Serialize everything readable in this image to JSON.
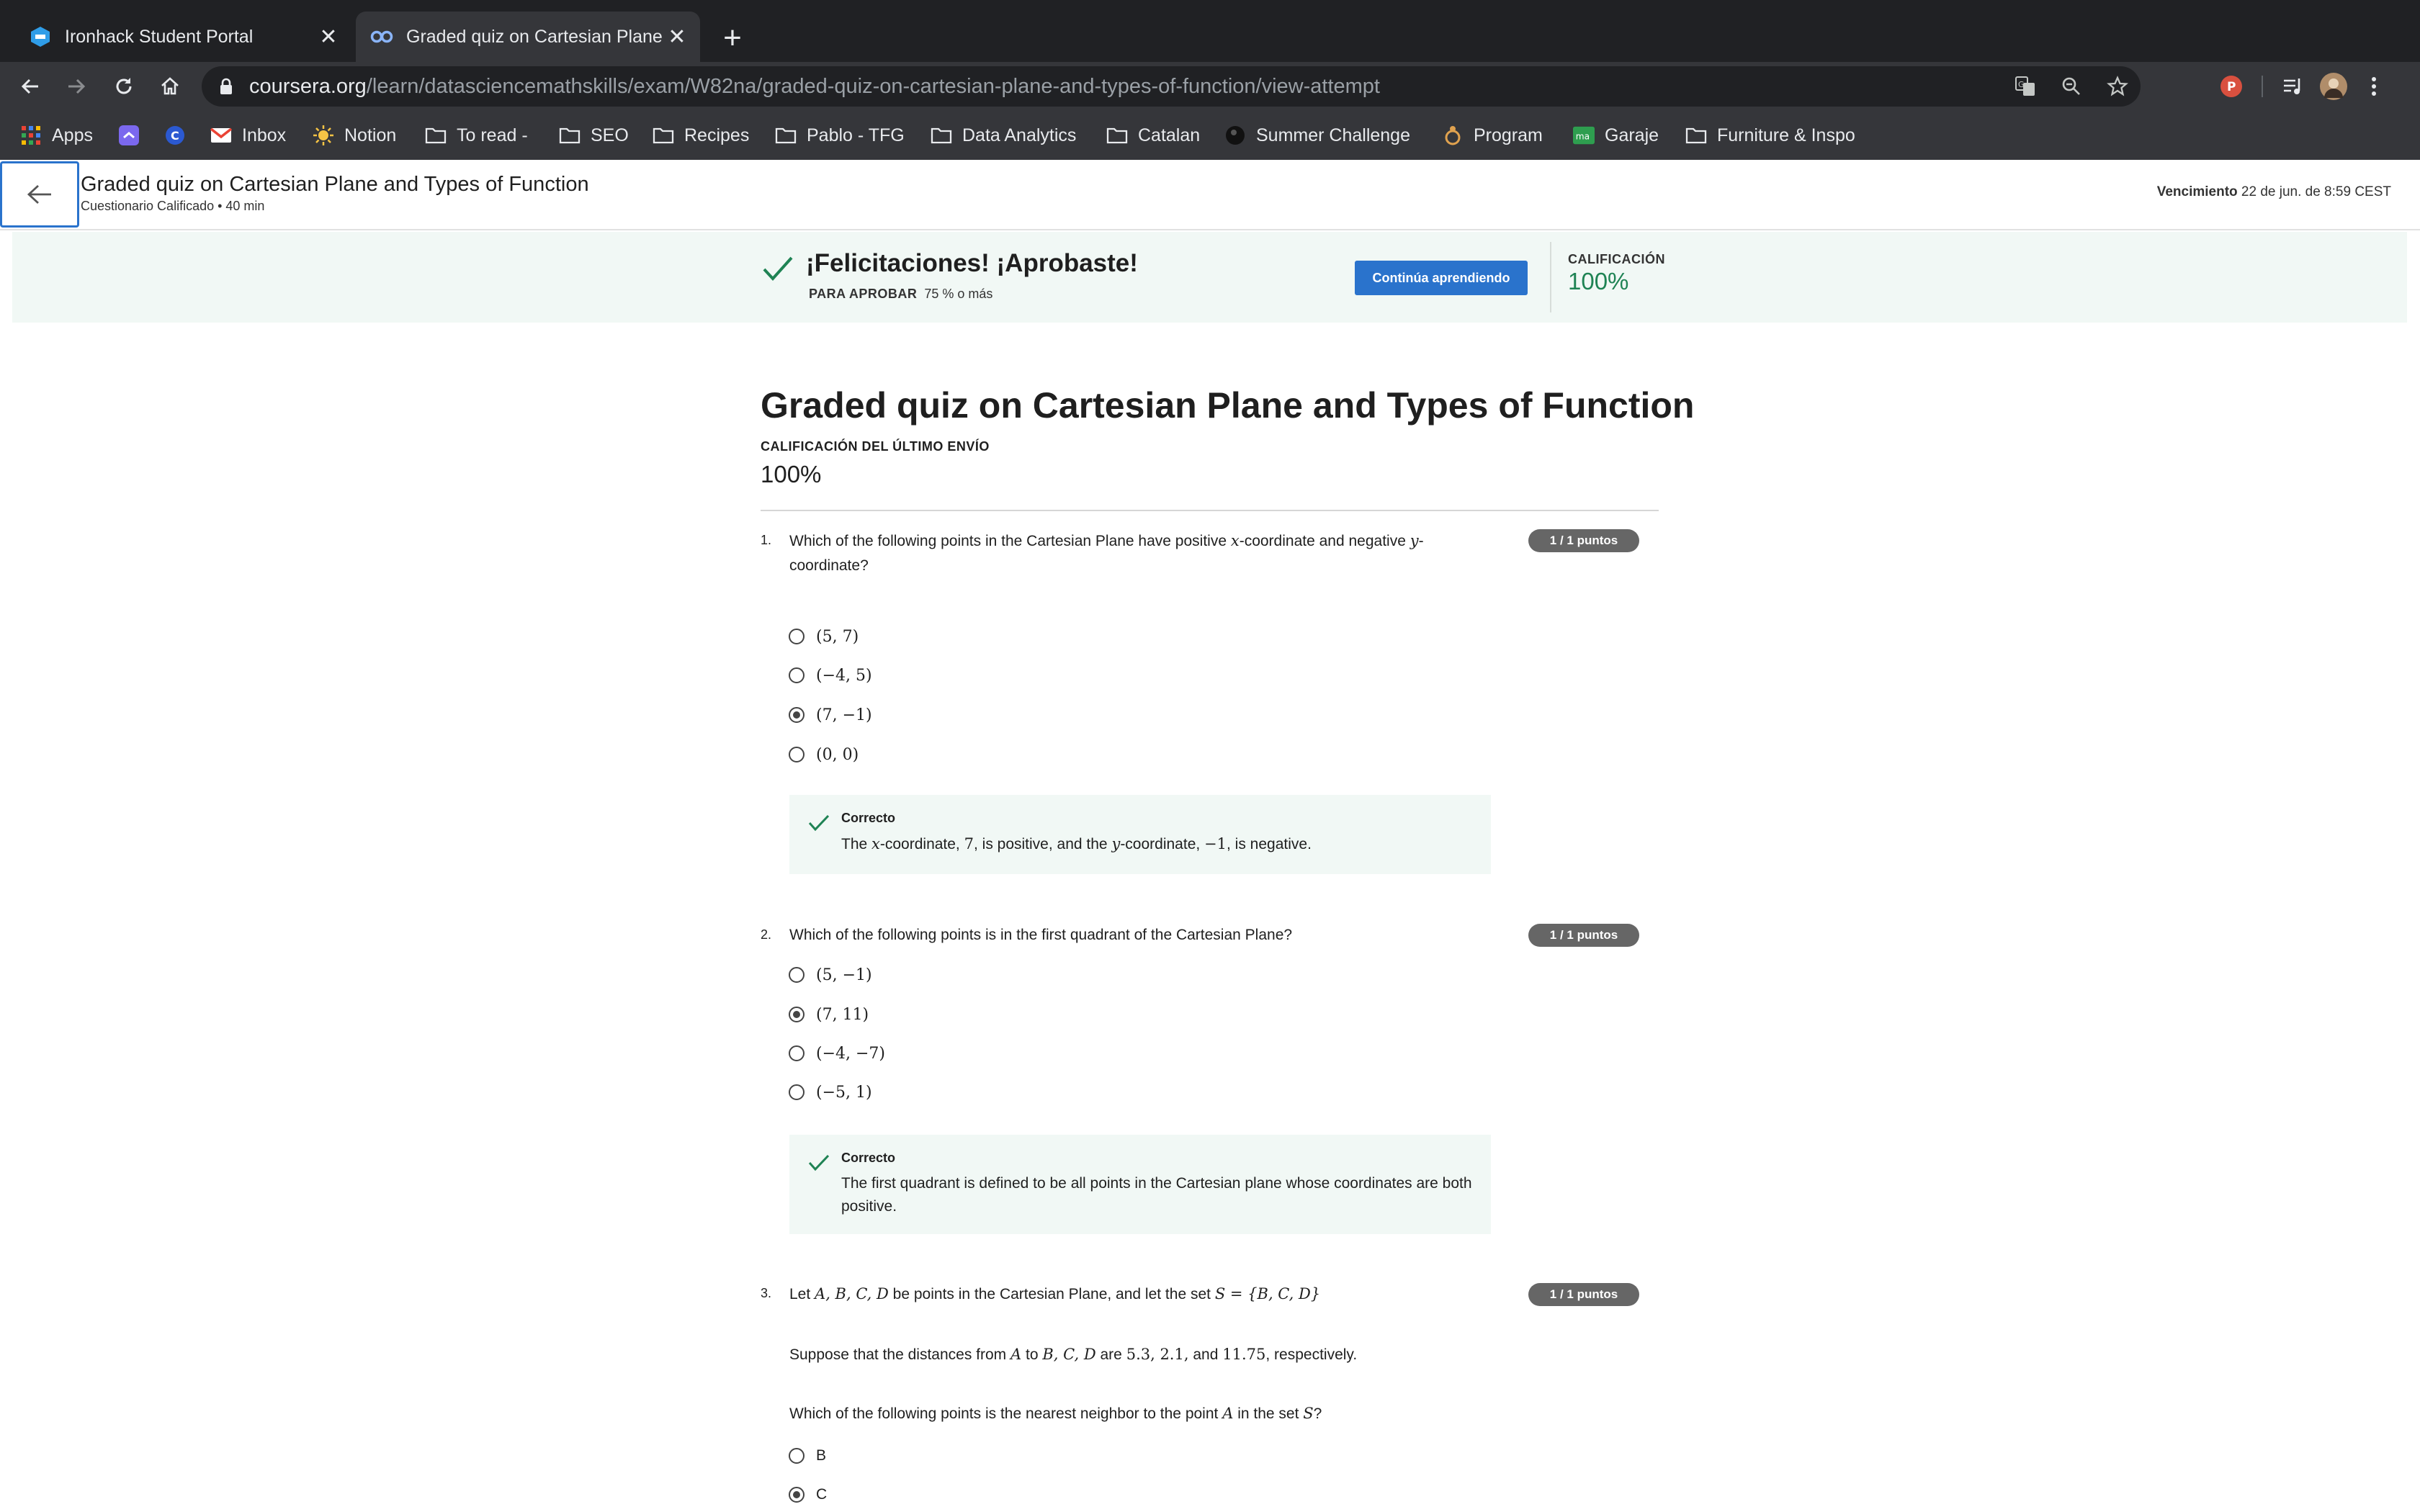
{
  "browser": {
    "tabs": [
      {
        "title": "Ironhack Student Portal"
      },
      {
        "title": "Graded quiz on Cartesian Plane and Types of Function"
      }
    ],
    "url_host": "coursera.org",
    "url_path": "/learn/datasciencemathskills/exam/W82na/graded-quiz-on-cartesian-plane-and-types-of-function/view-attempt",
    "profile_initial": "P",
    "bookmarks": [
      "Apps",
      "",
      "",
      "Inbox",
      "Notion",
      "To read -",
      "SEO",
      "Recipes",
      "Pablo - TFG",
      "Data Analytics",
      "Catalan",
      "Summer Challenge",
      "Program",
      "Garaje",
      "Furniture & Inspo"
    ],
    "garaje_badge": "ma"
  },
  "header": {
    "title": "Graded quiz on Cartesian Plane and Types of Function",
    "subtitle": "Cuestionario Calificado • 40 min",
    "due_label": "Vencimiento",
    "due_value": "22 de jun. de 8:59 CEST"
  },
  "banner": {
    "congrats": "¡Felicitaciones! ¡Aprobaste!",
    "pass_label": "PARA APROBAR",
    "pass_value": "75 % o más",
    "continue_label": "Continúa aprendiendo",
    "grade_label": "CALIFICACIÓN",
    "grade_value": "100%"
  },
  "quiz": {
    "title": "Graded quiz on Cartesian Plane and Types of Function",
    "last_label": "CALIFICACIÓN DEL ÚLTIMO ENVÍO",
    "last_value": "100%",
    "questions": [
      {
        "number": "1.",
        "text_a": "Which of the following points in the Cartesian Plane have positive ",
        "var_x": "x",
        "text_b": "-coordinate and negative ",
        "var_y": "y",
        "text_c": "-",
        "text_line2": "coordinate?",
        "points": "1 / 1 puntos",
        "options": [
          {
            "label": "(5, 7)",
            "selected": false
          },
          {
            "label": "(−4, 5)",
            "selected": false
          },
          {
            "label": "(7, −1)",
            "selected": true
          },
          {
            "label": "(0, 0)",
            "selected": false
          }
        ],
        "feedback_title": "Correcto",
        "fb_a": "The ",
        "fb_x": "x",
        "fb_b": "-coordinate, ",
        "fb_n1": "7",
        "fb_c": ", is positive, and the ",
        "fb_y": "y",
        "fb_d": "-coordinate, ",
        "fb_n2": "−1",
        "fb_e": ", is negative."
      },
      {
        "number": "2.",
        "text": "Which of the following points is in the first quadrant of the Cartesian Plane?",
        "points": "1 / 1 puntos",
        "options": [
          {
            "label": "(5, −1)",
            "selected": false
          },
          {
            "label": "(7, 11)",
            "selected": true
          },
          {
            "label": "(−4, −7)",
            "selected": false
          },
          {
            "label": "(−5, 1)",
            "selected": false
          }
        ],
        "feedback_title": "Correcto",
        "feedback_text": "The first quadrant is defined to be all points in the Cartesian plane whose coordinates are both positive."
      },
      {
        "number": "3.",
        "text_a": "Let ",
        "math_pts": "A, B, C, D",
        "text_b": " be points in the Cartesian Plane, and let the set ",
        "math_set": "S = {B, C, D}",
        "points": "1 / 1 puntos",
        "p2_a": "Suppose that the distances from ",
        "p2_A": "A",
        "p2_b": " to ",
        "p2_BCD": "B, C, D",
        "p2_c": " are ",
        "p2_nums": "5.3, 2.1,",
        "p2_d": " and ",
        "p2_last": "11.75",
        "p2_e": ", respectively.",
        "p3_a": "Which of the following points is the nearest neighbor to the point ",
        "p3_A": "A",
        "p3_b": " in the set ",
        "p3_S": "S",
        "p3_c": "?",
        "options": [
          {
            "label": "B",
            "selected": false
          },
          {
            "label": "C",
            "selected": true
          }
        ]
      }
    ]
  }
}
